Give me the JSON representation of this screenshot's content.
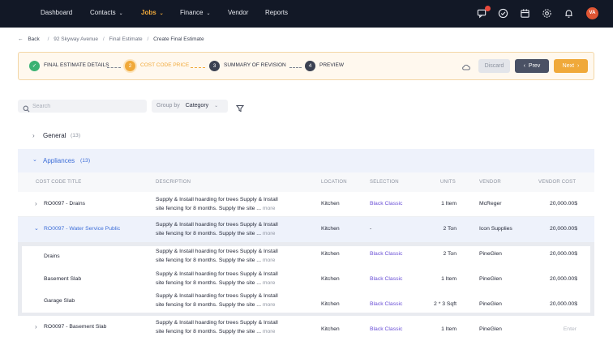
{
  "nav": {
    "items": [
      "Dashboard",
      "Contacts",
      "Jobs",
      "Finance",
      "Vendor",
      "Reports"
    ],
    "avatar": "VA"
  },
  "breadcrumb": {
    "back": "Back",
    "items": [
      "92 Skyway Avenue",
      "Final Estimate",
      "Create Final Estimate"
    ]
  },
  "stepper": {
    "steps": [
      {
        "num": "",
        "label": "FINAL ESTIMATE DETAILS",
        "state": "done"
      },
      {
        "num": "2",
        "label": "COST CODE PRICE",
        "state": "active"
      },
      {
        "num": "3",
        "label": "SUMMARY OF REVISION",
        "state": "todo"
      },
      {
        "num": "4",
        "label": "PREVIEW",
        "state": "todo"
      }
    ],
    "discard": "Discard",
    "prev": "Prev",
    "next": "Next"
  },
  "toolbar": {
    "search_placeholder": "Search",
    "group_by_label": "Group by",
    "group_by_value": "Category"
  },
  "groups": {
    "general": {
      "name": "General",
      "count": "(13)"
    },
    "appliances": {
      "name": "Appliances",
      "count": "(13)"
    }
  },
  "table": {
    "headers": [
      "COST CODE TITLE",
      "DESCRIPTION",
      "LOCATION",
      "SELECTION",
      "UNITS",
      "VENDOR",
      "VENDOR COST"
    ],
    "desc_line1": "Supply & Install hoarding for trees Supply & Install",
    "desc_line2": "site fencing for 8 months. Supply the site ...",
    "more": "more",
    "rows": [
      {
        "title": "RO0097 - Drains",
        "location": "Kitchen",
        "selection": "Black Classic",
        "units": "1 Item",
        "vendor": "McReger",
        "cost": "20,000.00$"
      },
      {
        "title": "RO0097 - Water Service Public",
        "location": "Kitchen",
        "selection": "-",
        "units": "2 Ton",
        "vendor": "Icon Supplies",
        "cost": "20,000.00$"
      },
      {
        "title": "Drains",
        "location": "Kitchen",
        "selection": "Black Classic",
        "units": "2 Ton",
        "vendor": "PineGlen",
        "cost": "20,000.00$"
      },
      {
        "title": "Basement Slab",
        "location": "Kitchen",
        "selection": "Black Classic",
        "units": "1 Item",
        "vendor": "PineGlen",
        "cost": "20,000.00$"
      },
      {
        "title": "Garage Slab",
        "location": "Kitchen",
        "selection": "Black Classic",
        "units": "2 * 3 Sqft",
        "vendor": "PineGlen",
        "cost": "20,000.00$"
      },
      {
        "title": "RO0097 - Basement Slab",
        "location": "Kitchen",
        "selection": "Black Classic",
        "units": "1 Item",
        "vendor": "PineGlen",
        "cost": "Enter"
      }
    ]
  },
  "colors": {
    "accent": "#f0a93a",
    "nav_bg": "#121826",
    "link": "#3d6ed8",
    "selection": "#6a4fd6",
    "done": "#3bb273"
  }
}
